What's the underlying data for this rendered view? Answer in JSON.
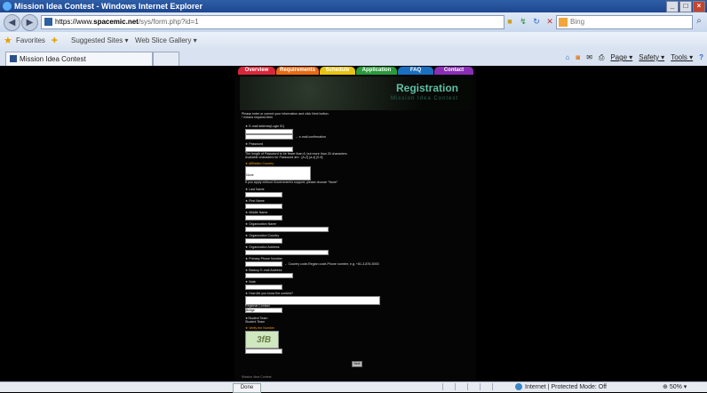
{
  "window": {
    "title": "Mission Idea Contest - Windows Internet Explorer",
    "min": "_",
    "max": "□",
    "close": "×"
  },
  "address": {
    "back": "◀",
    "forward": "▶",
    "url_prefix": "https://www.",
    "url_domain": "spacemic.net",
    "url_suffix": "/sys/form.php?id=1",
    "search_placeholder": "Bing",
    "search_go": "⌕"
  },
  "favorites": {
    "label": "Favorites",
    "suggested": "Suggested Sites ▾",
    "webslice": "Web Slice Gallery ▾"
  },
  "tab": {
    "title": "Mission Idea Contest"
  },
  "commandbar": {
    "page": "Page ▾",
    "safety": "Safety ▾",
    "tools": "Tools ▾",
    "help": "?"
  },
  "site": {
    "nav": [
      {
        "label": "Overview",
        "color": "#d9273a"
      },
      {
        "label": "Requirements",
        "color": "#e86a12"
      },
      {
        "label": "Schedule",
        "color": "#e8c412"
      },
      {
        "label": "Application",
        "color": "#2a9a3c"
      },
      {
        "label": "FAQ",
        "color": "#1a6fc0"
      },
      {
        "label": "Contact",
        "color": "#8a2fb5"
      }
    ],
    "banner_title": "Registration",
    "banner_sub": "Mission Idea Contest"
  },
  "form": {
    "intro": "Please enter or correct your information and click Next button.",
    "required_note": "* means required item",
    "email_label": "★ E-mail address(Login ID)",
    "email_confirm": "← e-mail confirmation",
    "password_label": "★ Password",
    "password_note1": "The length of Password to be fewer than 8, but more than 20 characters.",
    "password_note2": "Available characters for Password are : [A-Z] [a-z] [0-9]",
    "country_label": "★ Affiliation Country",
    "country_value": "None",
    "country_note": "If you apply without Government's support, please choose \"None\"",
    "last_name": "★ Last Name",
    "first_name": "★ First Name",
    "middle_name": "★ Middle Name",
    "org_name": "★ Organization Name",
    "org_country": "★ Organization Country",
    "org_address": "★ Organization Address",
    "phone": "★ Primary Phone Number",
    "phone_note": "← Country code-Region code-Phone number, e.g. +81-3-876-5000",
    "backup_email": "★ Backup E-mail Address",
    "note": "★ Note",
    "how_label": "★ How did you know the contest?",
    "region_label": "Regional Contact",
    "region_value": "Bridge",
    "student_label": "★Student Team",
    "student_option": "Student Team",
    "verify_label": "★ Verify the Number",
    "captcha_text": "3fB",
    "next_button": "Next",
    "footer_label": "Mission Idea Contest"
  },
  "status": {
    "done": "Done",
    "zone": "Internet | Protected Mode: Off",
    "zoom": "50%"
  }
}
